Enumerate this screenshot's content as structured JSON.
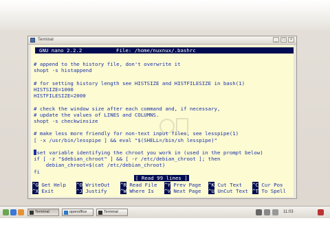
{
  "window": {
    "title": "Terminal",
    "buttons": [
      "_",
      "□",
      "×"
    ]
  },
  "nano": {
    "version": "GNU nano 2.2.2",
    "file": "File: /home/nuxnux/.bashrc",
    "lines": [
      "",
      "# append to the history file, don't overwrite it",
      "shopt -s histappend",
      "",
      "# for setting history length see HISTSIZE and HISTFILESIZE in bash(1)",
      "HISTSIZE=1000",
      "HISTFILESIZE=2000",
      "",
      "# check the window size after each command and, if necessary,",
      "# update the values of LINES and COLUMNS.",
      "shopt -s checkwinsize",
      "",
      "# make less more friendly for non-text input files, see lesspipe(1)",
      "[ -x /usr/bin/lesspipe ] && eval \"$(SHELL=/bin/sh lesspipe)\"",
      "",
      " set variable identifying the chroot you work in (used in the prompt below)",
      "if [ -z \"$debian_chroot\" ] && [ -r /etc/debian_chroot ]; then",
      "    debian_chroot=$(cat /etc/debian_chroot)",
      "fi"
    ],
    "cursor_line_prefix": "#",
    "status": "[ Read 99 lines ]",
    "shortcuts_row1": [
      {
        "key": "^G",
        "label": "Get Help"
      },
      {
        "key": "^O",
        "label": "WriteOut"
      },
      {
        "key": "^R",
        "label": "Read File"
      },
      {
        "key": "^Y",
        "label": "Prev Page"
      },
      {
        "key": "^K",
        "label": "Cut Text"
      },
      {
        "key": "^C",
        "label": "Cur Pos"
      }
    ],
    "shortcuts_row2": [
      {
        "key": "^X",
        "label": "Exit"
      },
      {
        "key": "^J",
        "label": "Justify"
      },
      {
        "key": "^W",
        "label": "Where Is"
      },
      {
        "key": "^V",
        "label": "Next Page"
      },
      {
        "key": "^U",
        "label": "UnCut Text"
      },
      {
        "key": "^T",
        "label": "To Spell"
      }
    ]
  },
  "taskbar": {
    "tasks": [
      "Terminal",
      "openoffice",
      "Terminal"
    ],
    "tray_time": "11:03"
  },
  "colors": {
    "terminal_bg": "#fcfbd2",
    "text": "#1a2fa8",
    "inverse_bg": "#000c52"
  }
}
